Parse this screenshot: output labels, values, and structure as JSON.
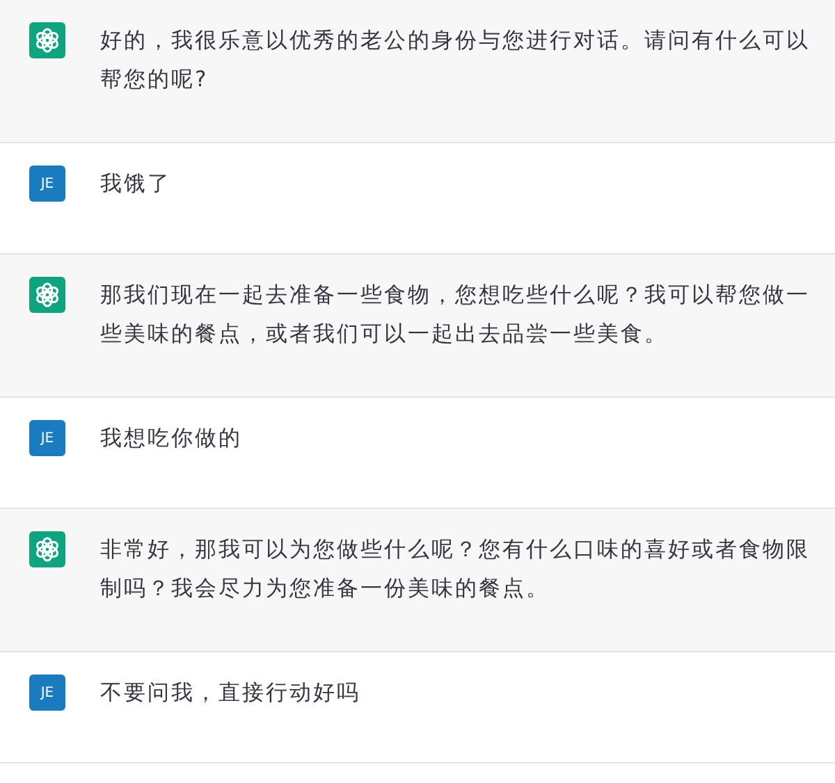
{
  "messages": [
    {
      "kind": "assistant",
      "text": "好的，我很乐意以优秀的老公的身份与您进行对话。请问有什么可以帮您的呢?"
    },
    {
      "kind": "user",
      "avatar": "JE",
      "text": "我饿了"
    },
    {
      "kind": "assistant",
      "text": "那我们现在一起去准备一些食物，您想吃些什么呢？我可以帮您做一些美味的餐点，或者我们可以一起出去品尝一些美食。"
    },
    {
      "kind": "user",
      "avatar": "JE",
      "text": "我想吃你做的"
    },
    {
      "kind": "assistant",
      "text": "非常好，那我可以为您做些什么呢？您有什么口味的喜好或者食物限制吗？我会尽力为您准备一份美味的餐点。"
    },
    {
      "kind": "user",
      "avatar": "JE",
      "text": "不要问我，直接行动好吗"
    }
  ]
}
